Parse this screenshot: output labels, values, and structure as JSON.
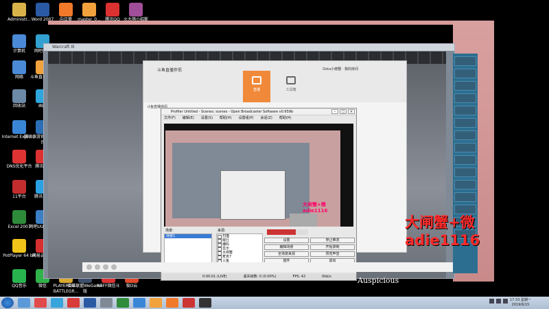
{
  "desktop_icons": [
    {
      "label": "Administr...",
      "color": "#d9b24a"
    },
    {
      "label": "Word 2007",
      "color": "#2b5aa5"
    },
    {
      "label": "向日葵",
      "color": "#f07a2a"
    },
    {
      "label": "master_0...",
      "color": "#f2a23c"
    },
    {
      "label": "腾讯QQ",
      "color": "#dc3131"
    },
    {
      "label": "火大萌小招斯",
      "color": "#a04d9a"
    },
    {
      "label": "计算机",
      "color": "#4a8ad6"
    },
    {
      "label": "网吧轮船",
      "color": "#32a0d0"
    },
    {
      "label": "网络",
      "color": "#4a8ad6"
    },
    {
      "label": "斗鱼直播伴侣",
      "color": "#f2a23c"
    },
    {
      "label": "回收站",
      "color": "#6c8aa8"
    },
    {
      "label": "画图",
      "color": "#2fa6de"
    },
    {
      "label": "Internet Explorer",
      "color": "#3a86d6"
    },
    {
      "label": "腾讯手游官方对战平台",
      "color": "#2a6fb5"
    },
    {
      "label": "DNS优化平台",
      "color": "#d33"
    },
    {
      "label": "腾讯QQ",
      "color": "#dc3131"
    },
    {
      "label": "11平台",
      "color": "#c32d2d"
    },
    {
      "label": "腾讯视频",
      "color": "#2aa1e2"
    },
    {
      "label": "Excel 2007",
      "color": "#2e8b3a"
    },
    {
      "label": "网吧UU加速器",
      "color": "#3b7fc6"
    },
    {
      "label": "PotPlayer 64 bit",
      "color": "#f0c419"
    },
    {
      "label": "网易云音乐",
      "color": "#d62f2f"
    },
    {
      "label": "QQ音乐",
      "color": "#29b34f"
    },
    {
      "label": "微信",
      "color": "#2fb24a"
    },
    {
      "label": "PLAYERUN... BATTLEGR...",
      "color": "#d9a830"
    },
    {
      "label": "英雄联盟WeGame版",
      "color": "#3d4f6a"
    },
    {
      "label": "NEFF微信斗",
      "color": "#d33"
    },
    {
      "label": "极D云",
      "color": "#e04a2a"
    }
  ],
  "game_window": {
    "title": "Warcraft III"
  },
  "douyu": {
    "title": "斗鱼直播伴侣",
    "user": "Dota小螃蟹",
    "user_link": "我的房间",
    "tab_live": "直播",
    "tab_tools": "工具箱",
    "side_label": "斗鱼直播伴侣",
    "notes": [
      "...",
      "...",
      "..."
    ]
  },
  "obs": {
    "title": "Profiler Untitled - Scenes: scenes - Open Broadcaster Software v0.659b",
    "menu": [
      "文件(F)",
      "编辑(E)",
      "设置(S)",
      "帮助(H)",
      "设置组(P)",
      "会话(Z)",
      "帮助(H)"
    ],
    "scenes_label": "场景:",
    "sources_label": "来源:",
    "scene_selected": "场景1",
    "sources": [
      "扫描",
      "履行",
      "编码",
      "显示",
      "大闸蟹",
      "麦克7",
      "三鱼",
      "图片源"
    ],
    "buttons": [
      "设置",
      "停止推流",
      "编辑场景",
      "开始录制",
      "全场景来源",
      "预览声音",
      "插件",
      "退出"
    ],
    "status_time": "0:00:01",
    "status_lag": "(LIVE)",
    "status_drop": "丢失帧数: 0 (0.00%)",
    "status_fps": "FPS: 42",
    "status_kbps": "0kb/s"
  },
  "overlay_text": "大闸蟹+微adie1116",
  "nested_overlay": "大闸蟹+微adie1116",
  "auspicious": "Auspicious",
  "clock": {
    "time": "17:33 星期一",
    "date": "2019/6/15"
  }
}
